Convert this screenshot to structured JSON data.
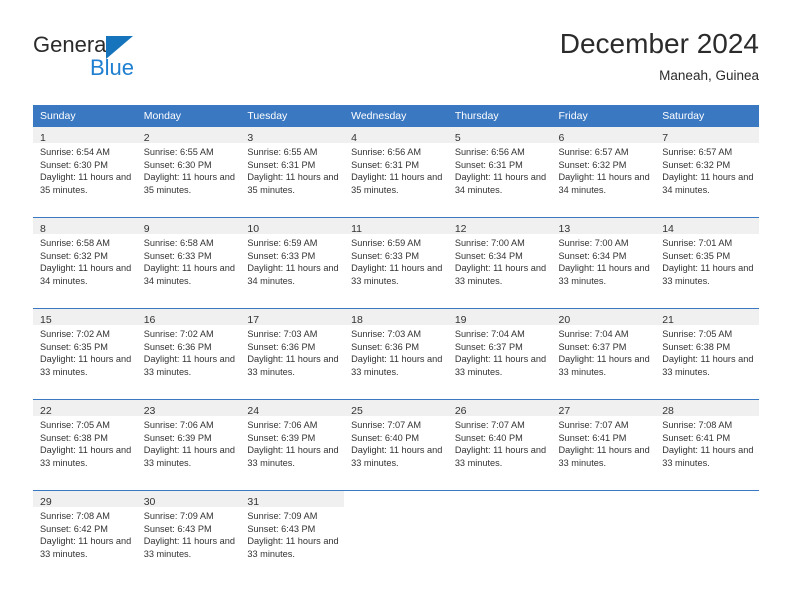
{
  "brand": {
    "name_part1": "General",
    "name_part2": "Blue",
    "logo_icon": "triangle-logo-icon"
  },
  "header": {
    "title": "December 2024",
    "subtitle": "Maneah, Guinea"
  },
  "colors": {
    "header_blue": "#3b78c2",
    "brand_blue": "#1f7fd0",
    "daynum_band": "#f0f0f0",
    "text": "#333333"
  },
  "calendar": {
    "weekday_headers": [
      "Sunday",
      "Monday",
      "Tuesday",
      "Wednesday",
      "Thursday",
      "Friday",
      "Saturday"
    ],
    "labels": {
      "sunrise_prefix": "Sunrise:",
      "sunset_prefix": "Sunset:",
      "daylight_prefix": "Daylight:"
    },
    "weeks": [
      [
        {
          "day": "1",
          "sunrise": "Sunrise: 6:54 AM",
          "sunset": "Sunset: 6:30 PM",
          "daylight": "Daylight: 11 hours and 35 minutes."
        },
        {
          "day": "2",
          "sunrise": "Sunrise: 6:55 AM",
          "sunset": "Sunset: 6:30 PM",
          "daylight": "Daylight: 11 hours and 35 minutes."
        },
        {
          "day": "3",
          "sunrise": "Sunrise: 6:55 AM",
          "sunset": "Sunset: 6:31 PM",
          "daylight": "Daylight: 11 hours and 35 minutes."
        },
        {
          "day": "4",
          "sunrise": "Sunrise: 6:56 AM",
          "sunset": "Sunset: 6:31 PM",
          "daylight": "Daylight: 11 hours and 35 minutes."
        },
        {
          "day": "5",
          "sunrise": "Sunrise: 6:56 AM",
          "sunset": "Sunset: 6:31 PM",
          "daylight": "Daylight: 11 hours and 34 minutes."
        },
        {
          "day": "6",
          "sunrise": "Sunrise: 6:57 AM",
          "sunset": "Sunset: 6:32 PM",
          "daylight": "Daylight: 11 hours and 34 minutes."
        },
        {
          "day": "7",
          "sunrise": "Sunrise: 6:57 AM",
          "sunset": "Sunset: 6:32 PM",
          "daylight": "Daylight: 11 hours and 34 minutes."
        }
      ],
      [
        {
          "day": "8",
          "sunrise": "Sunrise: 6:58 AM",
          "sunset": "Sunset: 6:32 PM",
          "daylight": "Daylight: 11 hours and 34 minutes."
        },
        {
          "day": "9",
          "sunrise": "Sunrise: 6:58 AM",
          "sunset": "Sunset: 6:33 PM",
          "daylight": "Daylight: 11 hours and 34 minutes."
        },
        {
          "day": "10",
          "sunrise": "Sunrise: 6:59 AM",
          "sunset": "Sunset: 6:33 PM",
          "daylight": "Daylight: 11 hours and 34 minutes."
        },
        {
          "day": "11",
          "sunrise": "Sunrise: 6:59 AM",
          "sunset": "Sunset: 6:33 PM",
          "daylight": "Daylight: 11 hours and 33 minutes."
        },
        {
          "day": "12",
          "sunrise": "Sunrise: 7:00 AM",
          "sunset": "Sunset: 6:34 PM",
          "daylight": "Daylight: 11 hours and 33 minutes."
        },
        {
          "day": "13",
          "sunrise": "Sunrise: 7:00 AM",
          "sunset": "Sunset: 6:34 PM",
          "daylight": "Daylight: 11 hours and 33 minutes."
        },
        {
          "day": "14",
          "sunrise": "Sunrise: 7:01 AM",
          "sunset": "Sunset: 6:35 PM",
          "daylight": "Daylight: 11 hours and 33 minutes."
        }
      ],
      [
        {
          "day": "15",
          "sunrise": "Sunrise: 7:02 AM",
          "sunset": "Sunset: 6:35 PM",
          "daylight": "Daylight: 11 hours and 33 minutes."
        },
        {
          "day": "16",
          "sunrise": "Sunrise: 7:02 AM",
          "sunset": "Sunset: 6:36 PM",
          "daylight": "Daylight: 11 hours and 33 minutes."
        },
        {
          "day": "17",
          "sunrise": "Sunrise: 7:03 AM",
          "sunset": "Sunset: 6:36 PM",
          "daylight": "Daylight: 11 hours and 33 minutes."
        },
        {
          "day": "18",
          "sunrise": "Sunrise: 7:03 AM",
          "sunset": "Sunset: 6:36 PM",
          "daylight": "Daylight: 11 hours and 33 minutes."
        },
        {
          "day": "19",
          "sunrise": "Sunrise: 7:04 AM",
          "sunset": "Sunset: 6:37 PM",
          "daylight": "Daylight: 11 hours and 33 minutes."
        },
        {
          "day": "20",
          "sunrise": "Sunrise: 7:04 AM",
          "sunset": "Sunset: 6:37 PM",
          "daylight": "Daylight: 11 hours and 33 minutes."
        },
        {
          "day": "21",
          "sunrise": "Sunrise: 7:05 AM",
          "sunset": "Sunset: 6:38 PM",
          "daylight": "Daylight: 11 hours and 33 minutes."
        }
      ],
      [
        {
          "day": "22",
          "sunrise": "Sunrise: 7:05 AM",
          "sunset": "Sunset: 6:38 PM",
          "daylight": "Daylight: 11 hours and 33 minutes."
        },
        {
          "day": "23",
          "sunrise": "Sunrise: 7:06 AM",
          "sunset": "Sunset: 6:39 PM",
          "daylight": "Daylight: 11 hours and 33 minutes."
        },
        {
          "day": "24",
          "sunrise": "Sunrise: 7:06 AM",
          "sunset": "Sunset: 6:39 PM",
          "daylight": "Daylight: 11 hours and 33 minutes."
        },
        {
          "day": "25",
          "sunrise": "Sunrise: 7:07 AM",
          "sunset": "Sunset: 6:40 PM",
          "daylight": "Daylight: 11 hours and 33 minutes."
        },
        {
          "day": "26",
          "sunrise": "Sunrise: 7:07 AM",
          "sunset": "Sunset: 6:40 PM",
          "daylight": "Daylight: 11 hours and 33 minutes."
        },
        {
          "day": "27",
          "sunrise": "Sunrise: 7:07 AM",
          "sunset": "Sunset: 6:41 PM",
          "daylight": "Daylight: 11 hours and 33 minutes."
        },
        {
          "day": "28",
          "sunrise": "Sunrise: 7:08 AM",
          "sunset": "Sunset: 6:41 PM",
          "daylight": "Daylight: 11 hours and 33 minutes."
        }
      ],
      [
        {
          "day": "29",
          "sunrise": "Sunrise: 7:08 AM",
          "sunset": "Sunset: 6:42 PM",
          "daylight": "Daylight: 11 hours and 33 minutes."
        },
        {
          "day": "30",
          "sunrise": "Sunrise: 7:09 AM",
          "sunset": "Sunset: 6:43 PM",
          "daylight": "Daylight: 11 hours and 33 minutes."
        },
        {
          "day": "31",
          "sunrise": "Sunrise: 7:09 AM",
          "sunset": "Sunset: 6:43 PM",
          "daylight": "Daylight: 11 hours and 33 minutes."
        },
        {
          "day": "",
          "sunrise": "",
          "sunset": "",
          "daylight": ""
        },
        {
          "day": "",
          "sunrise": "",
          "sunset": "",
          "daylight": ""
        },
        {
          "day": "",
          "sunrise": "",
          "sunset": "",
          "daylight": ""
        },
        {
          "day": "",
          "sunrise": "",
          "sunset": "",
          "daylight": ""
        }
      ]
    ]
  }
}
